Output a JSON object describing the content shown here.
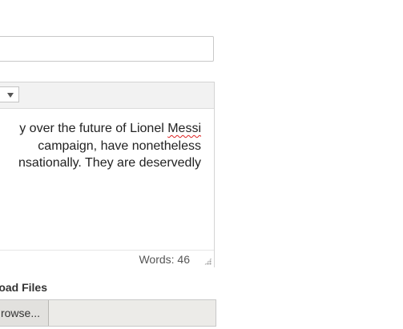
{
  "editor": {
    "lines": [
      "y over the future of Lionel ",
      " campaign, have nonetheless",
      "nsationally. They are deservedly"
    ],
    "misspelled_word": "Messi",
    "word_count": "Words: 46"
  },
  "upload": {
    "label": "oad Files",
    "browse_label": "rowse..."
  }
}
